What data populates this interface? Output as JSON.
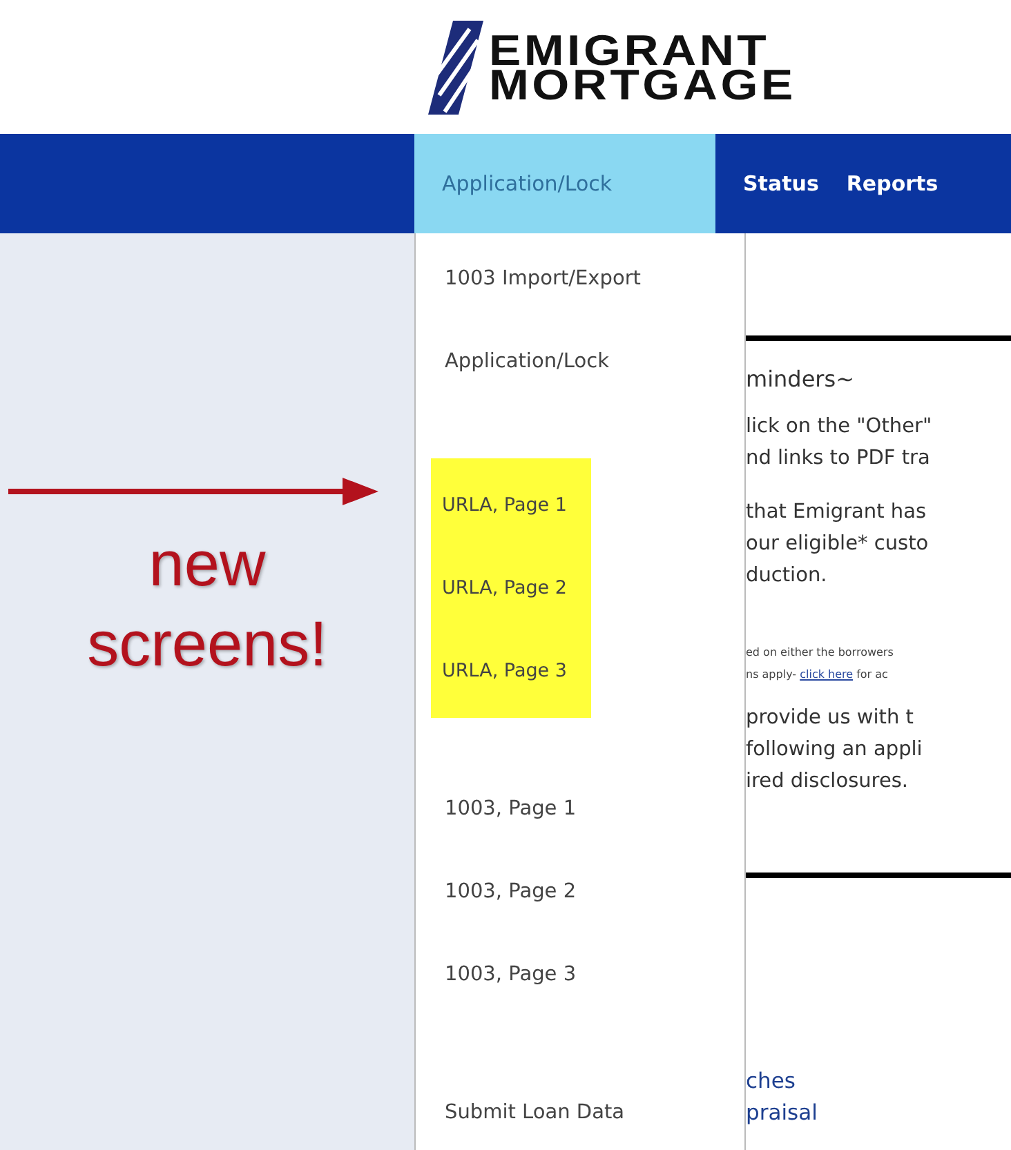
{
  "logo": {
    "lines": [
      "EMIGRANT",
      "MORTGAGE"
    ]
  },
  "nav": [
    {
      "label": "Application/Lock",
      "selected": true
    },
    {
      "label": "Status",
      "selected": false
    },
    {
      "label": "Reports",
      "selected": false
    }
  ],
  "callout": {
    "lines": [
      "new",
      "screens!"
    ]
  },
  "menu": [
    {
      "highlighted": false,
      "items": [
        "1003 Import/Export",
        "Application/Lock"
      ]
    },
    {
      "highlighted": true,
      "items": [
        "URLA, Page 1",
        "URLA, Page 2",
        "URLA, Page 3"
      ]
    },
    {
      "highlighted": false,
      "items": [
        "1003, Page 1",
        "1003, Page 2",
        "1003, Page 3"
      ]
    },
    {
      "highlighted": false,
      "items": [
        "Submit Loan Data"
      ]
    }
  ],
  "content": {
    "heading": "minders~",
    "para1": [
      "lick on the \"Other\"",
      "nd links to PDF tra"
    ],
    "para2": [
      "that Emigrant has",
      "our eligible* custo",
      "duction."
    ],
    "fine_print": [
      "ed on either the borrowers",
      "ns apply- "
    ],
    "fine_link": "click here",
    "fine_tail": " for ac",
    "para3": [
      "provide us with t",
      "following an appli",
      "ired disclosures."
    ],
    "links": [
      "ches",
      "praisal"
    ]
  }
}
